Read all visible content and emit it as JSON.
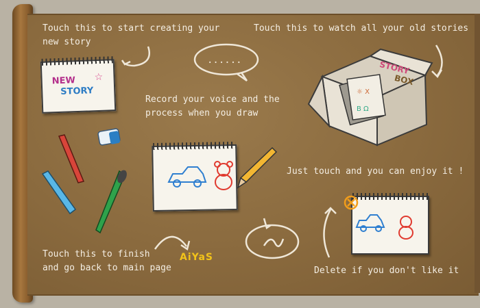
{
  "hints": {
    "new_story": "Touch this to start creating your\nnew story",
    "old_stories": "Touch this to watch all your old stories",
    "record": "Record your voice and the\nprocess when you draw",
    "enjoy": "Just touch and you can enjoy it !",
    "finish": "Touch this to finish\nand go back to main page",
    "delete": "Delete if you don't like it"
  },
  "new_story_button": {
    "line1": "NEW",
    "line2": "STORY"
  },
  "story_box": {
    "line1": "STORY",
    "line2": "BOX"
  },
  "logo": {
    "text": "AiYaS"
  },
  "colors": {
    "board": "#8a6a3e",
    "chalk_text": "#f4eee3",
    "accent_orange": "#f29d1a"
  }
}
